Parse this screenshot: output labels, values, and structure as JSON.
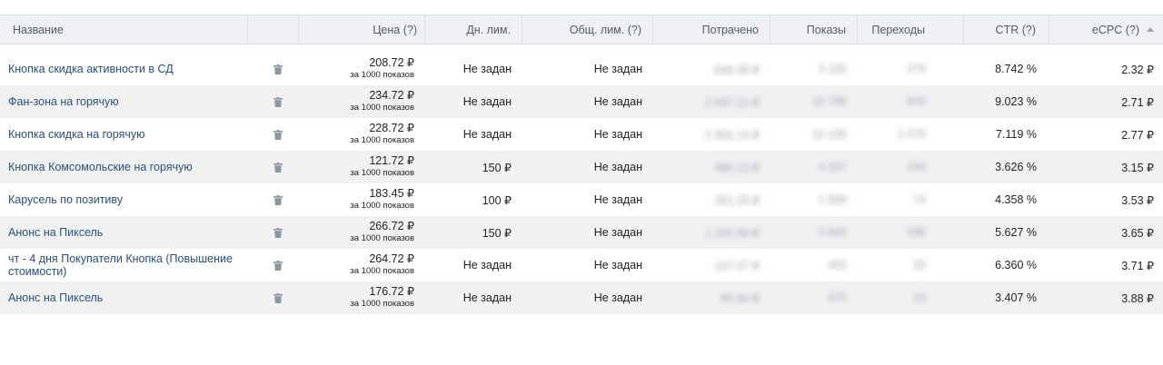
{
  "columns": {
    "name": "Название",
    "price": "Цена (?)",
    "daily_limit": "Дн. лим.",
    "total_limit": "Общ. лим. (?)",
    "spent": "Потрачено",
    "views": "Показы",
    "clicks": "Переходы",
    "ctr": "CTR (?)",
    "ecpc": "eCPC (?)"
  },
  "price_subtitle": "за 1000 показов",
  "rows": [
    {
      "name": "Кнопка скидка активности в СД",
      "price": "208.72 ₽",
      "daily": "Не задан",
      "total": "Не задан",
      "spent": "648.38 ₽",
      "views": "3 100",
      "clicks": "279",
      "ctr": "8.742 %",
      "ecpc": "2.32 ₽"
    },
    {
      "name": "Фан-зона на горячую",
      "price": "234.72 ₽",
      "daily": "Не задан",
      "total": "Не задан",
      "spent": "2 637.21 ₽",
      "views": "10 756",
      "clicks": "970",
      "ctr": "9.023 %",
      "ecpc": "2.71 ₽"
    },
    {
      "name": "Кнопка скидка на горячую",
      "price": "228.72 ₽",
      "daily": "Не задан",
      "total": "Не задан",
      "spent": "2 956.14 ₽",
      "views": "15 136",
      "clicks": "1 075",
      "ctr": "7.119 %",
      "ecpc": "2.77 ₽"
    },
    {
      "name": "Кнопка Комсомольские на горячую",
      "price": "121.72 ₽",
      "daily": "150 ₽",
      "total": "Не задан",
      "spent": "490.13 ₽",
      "views": "4 207",
      "clicks": "156",
      "ctr": "3.626 %",
      "ecpc": "3.15 ₽"
    },
    {
      "name": "Карусель по позитиву",
      "price": "183.45 ₽",
      "daily": "100 ₽",
      "total": "Не задан",
      "spent": "261.29 ₽",
      "views": "1 699",
      "clicks": "74",
      "ctr": "4.358 %",
      "ecpc": "3.53 ₽"
    },
    {
      "name": "Анонс на Пиксель",
      "price": "266.72 ₽",
      "daily": "150 ₽",
      "total": "Не задан",
      "spent": "1 205.59 ₽",
      "views": "5 820",
      "clicks": "330",
      "ctr": "5.627 %",
      "ecpc": "3.65 ₽"
    },
    {
      "name": "чт - 4 дня Покупатели Кнопка (Повышение стоимости)",
      "price": "264.72 ₽",
      "daily": "Не задан",
      "total": "Не задан",
      "spent": "107.07 ₽",
      "views": "455",
      "clicks": "29",
      "ctr": "6.360 %",
      "ecpc": "3.71 ₽"
    },
    {
      "name": "Анонс на Пиксель",
      "price": "176.72 ₽",
      "daily": "Не задан",
      "total": "Не задан",
      "spent": "85.60 ₽",
      "views": "675",
      "clicks": "23",
      "ctr": "3.407 %",
      "ecpc": "3.88 ₽"
    }
  ],
  "icons": {
    "delete": "trash-icon",
    "sort": "sort-ascending-icon"
  },
  "colors": {
    "header_bg": "#eef0f4",
    "alt_row_bg": "#f0f1f3",
    "link": "#2c4e73",
    "icon": "#8c96a3"
  }
}
